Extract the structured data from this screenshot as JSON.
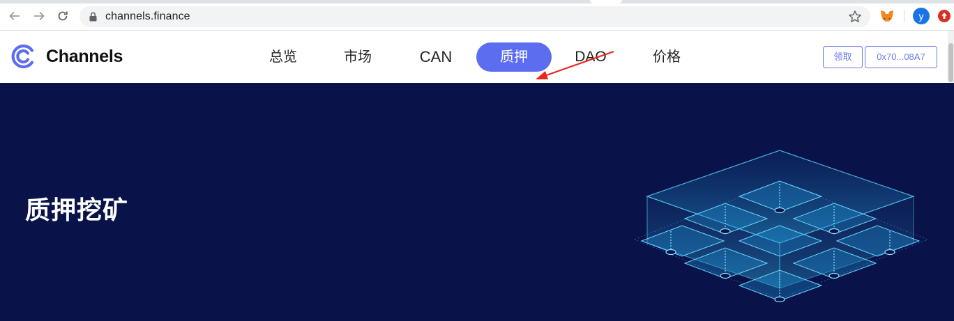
{
  "browser": {
    "url": "channels.finance",
    "back_icon": "arrow-left-icon",
    "forward_icon": "arrow-right-icon",
    "reload_icon": "reload-icon",
    "lock_icon": "lock-icon",
    "bookmark_icon": "star-icon",
    "extension_icon": "metamask-fox-icon",
    "profile_initial": "y"
  },
  "header": {
    "brand": "Channels",
    "nav": [
      {
        "label": "总览"
      },
      {
        "label": "市场"
      },
      {
        "label": "CAN"
      },
      {
        "label": "质押",
        "active": true
      },
      {
        "label": "DAO"
      },
      {
        "label": "价格"
      }
    ],
    "claim_label": "领取",
    "wallet_label": "0x70...08A7",
    "accent_color": "#5d6df0"
  },
  "hero": {
    "title": "质押挖矿",
    "background_color": "#0a1349"
  },
  "annotation": {
    "arrow_color": "#e8271f"
  }
}
